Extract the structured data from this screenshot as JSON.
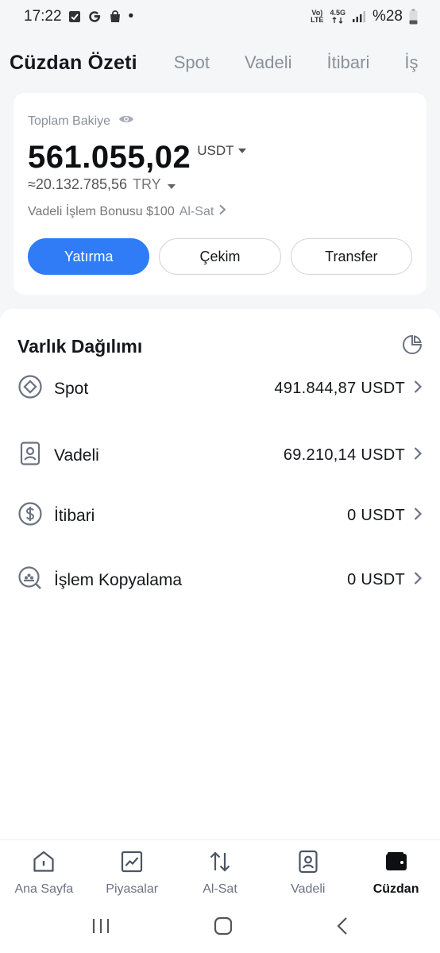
{
  "status_bar": {
    "time": "17:22",
    "dot": "•",
    "volte_top": "Vo)",
    "volte_bottom": "LTE",
    "network": "4.5G",
    "battery": "%28"
  },
  "top_tabs": [
    {
      "label": "Cüzdan Özeti",
      "active": true
    },
    {
      "label": "Spot",
      "active": false
    },
    {
      "label": "Vadeli",
      "active": false
    },
    {
      "label": "İtibari",
      "active": false
    },
    {
      "label": "İş",
      "active": false
    }
  ],
  "balance": {
    "label": "Toplam Bakiye",
    "value": "561.055,02",
    "unit": "USDT",
    "approx": "≈20.132.785,56",
    "approx_unit": "TRY",
    "bonus_text": "Vadeli İşlem Bonusu $100",
    "bonus_link": "Al-Sat"
  },
  "actions": {
    "deposit": "Yatırma",
    "withdraw": "Çekim",
    "transfer": "Transfer"
  },
  "assets": {
    "title": "Varlık Dağılımı",
    "rows": [
      {
        "name": "Spot",
        "value": "491.844,87 USDT"
      },
      {
        "name": "Vadeli",
        "value": "69.210,14 USDT"
      },
      {
        "name": "İtibari",
        "value": "0 USDT"
      },
      {
        "name": "İşlem Kopyalama",
        "value": "0 USDT"
      }
    ]
  },
  "bottom_nav": [
    {
      "label": "Ana Sayfa"
    },
    {
      "label": "Piyasalar"
    },
    {
      "label": "Al-Sat"
    },
    {
      "label": "Vadeli"
    },
    {
      "label": "Cüzdan"
    }
  ],
  "colors": {
    "accent": "#2f7cf6",
    "background": "#f5f6f8",
    "text": "#15171c",
    "muted": "#8a9199"
  }
}
